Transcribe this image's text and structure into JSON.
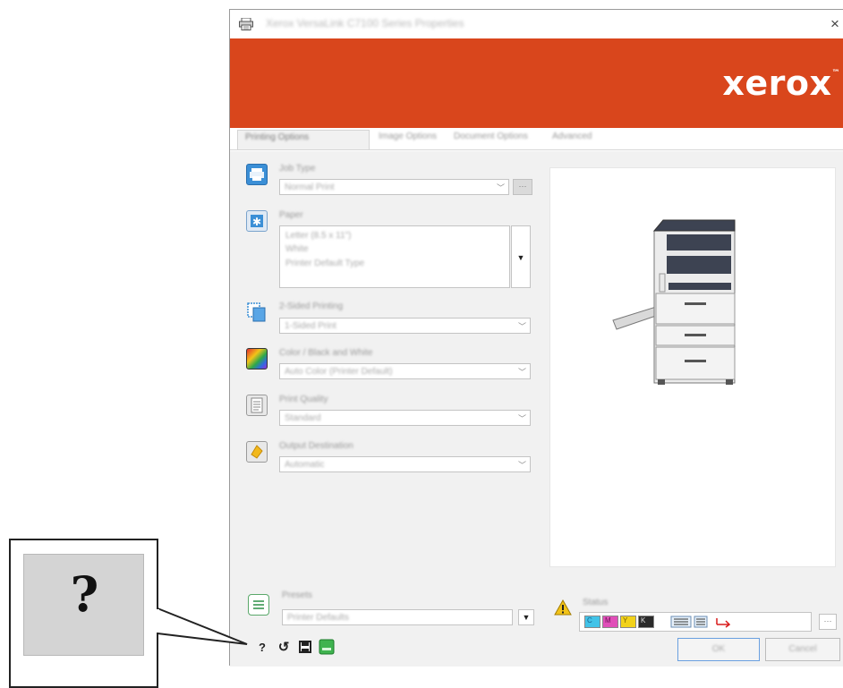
{
  "window": {
    "title": "Xerox VersaLink C7100 Series Properties",
    "close_glyph": "×"
  },
  "banner": {
    "brand": "xerox",
    "trademark": "™",
    "color": "#d9461c"
  },
  "tabs": [
    {
      "label": "Printing Options",
      "active": true
    },
    {
      "label": "Image Options",
      "active": false
    },
    {
      "label": "Document Options",
      "active": false
    },
    {
      "label": "Advanced",
      "active": false
    }
  ],
  "options": {
    "job_type": {
      "label": "Job Type",
      "value": "Normal Print",
      "icon": "printer-icon"
    },
    "paper": {
      "label": "Paper",
      "lines": [
        "Letter (8.5 x 11\")",
        "White",
        "Printer Default Type"
      ],
      "icon": "paper-icon"
    },
    "two_sided": {
      "label": "2-Sided Printing",
      "value": "1-Sided Print",
      "icon": "two-sided-icon"
    },
    "color": {
      "label": "Color / Black and White",
      "value": "Auto Color (Printer Default)",
      "icon": "color-icon"
    },
    "print_quality": {
      "label": "Print Quality",
      "value": "Standard",
      "icon": "print-quality-icon"
    },
    "output_destination": {
      "label": "Output Destination",
      "value": "Automatic",
      "icon": "output-icon"
    }
  },
  "bottom": {
    "presets": {
      "label": "Presets",
      "value": "Printer Defaults",
      "icon": "presets-icon"
    },
    "status": {
      "label": "Status",
      "icon": "warning-icon"
    },
    "ok_label": "OK",
    "cancel_label": "Cancel"
  },
  "toolbar": {
    "help": "?",
    "reset": "↺",
    "save": "🖫"
  },
  "callout": {
    "glyph": "?"
  },
  "toner": [
    {
      "letter": "C",
      "color": "#42c3e8"
    },
    {
      "letter": "M",
      "color": "#e04fb8"
    },
    {
      "letter": "Y",
      "color": "#f2d21b"
    },
    {
      "letter": "K",
      "color": "#2a2a2a"
    }
  ]
}
